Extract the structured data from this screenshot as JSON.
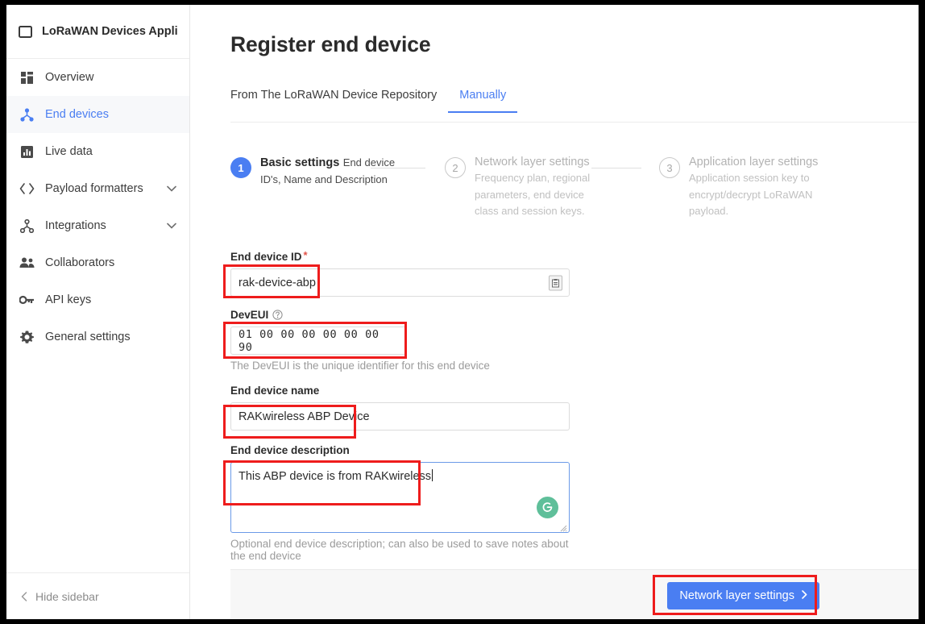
{
  "sidebar": {
    "app_title": "LoRaWAN Devices Applica…",
    "app_icon": "window-icon",
    "items": [
      {
        "label": "Overview",
        "icon": "grid-icon",
        "active": false,
        "expandable": false
      },
      {
        "label": "End devices",
        "icon": "device-tree-icon",
        "active": true,
        "expandable": false
      },
      {
        "label": "Live data",
        "icon": "chart-bar-icon",
        "active": false,
        "expandable": false
      },
      {
        "label": "Payload formatters",
        "icon": "code-brackets-icon",
        "active": false,
        "expandable": true
      },
      {
        "label": "Integrations",
        "icon": "integrations-icon",
        "active": false,
        "expandable": true
      },
      {
        "label": "Collaborators",
        "icon": "people-icon",
        "active": false,
        "expandable": false
      },
      {
        "label": "API keys",
        "icon": "key-icon",
        "active": false,
        "expandable": false
      },
      {
        "label": "General settings",
        "icon": "gear-icon",
        "active": false,
        "expandable": false
      }
    ],
    "hide_sidebar_label": "Hide sidebar",
    "hide_sidebar_icon": "chevron-left-icon"
  },
  "main": {
    "page_title": "Register end device",
    "tabs": [
      {
        "label": "From The LoRaWAN Device Repository",
        "active": false
      },
      {
        "label": "Manually",
        "active": true
      }
    ],
    "stepper": [
      {
        "number": "1",
        "title": "Basic settings",
        "description": "End device ID's, Name and Description",
        "state": "current"
      },
      {
        "number": "2",
        "title": "Network layer settings",
        "description": "Frequency plan, regional parameters, end device class and session keys.",
        "state": "pending"
      },
      {
        "number": "3",
        "title": "Application layer settings",
        "description": "Application session key to encrypt/decrypt LoRaWAN payload.",
        "state": "pending"
      }
    ],
    "form": {
      "end_device_id": {
        "label": "End device ID",
        "required_marker": "*",
        "value": "rak-device-abp",
        "placeholder": "",
        "paste_icon": "paste-icon"
      },
      "dev_eui": {
        "label": "DevEUI",
        "help_icon": "question-circle-icon",
        "value": "01 00 00 00 00 00 00 90",
        "hint": "The DevEUI is the unique identifier for this end device"
      },
      "end_device_name": {
        "label": "End device name",
        "value": "RAKwireless ABP Device",
        "placeholder": ""
      },
      "end_device_description": {
        "label": "End device description",
        "value": "This ABP device is from RAKwireless",
        "hint": "Optional end device description; can also be used to save notes about the end device",
        "grammarly_icon": "grammarly-g-icon",
        "grammarly_glyph": "G",
        "resize_icon": "resize-grip-icon"
      }
    },
    "footer": {
      "next_button_label": "Network layer settings",
      "next_button_icon": "chevron-right-icon"
    }
  },
  "colors": {
    "accent": "#4a7ef2",
    "annotation": "#ee1c1c",
    "grammarly_green": "#5fbf9a",
    "required_red": "#e2544a",
    "footer_bg": "#f7f7f7"
  }
}
